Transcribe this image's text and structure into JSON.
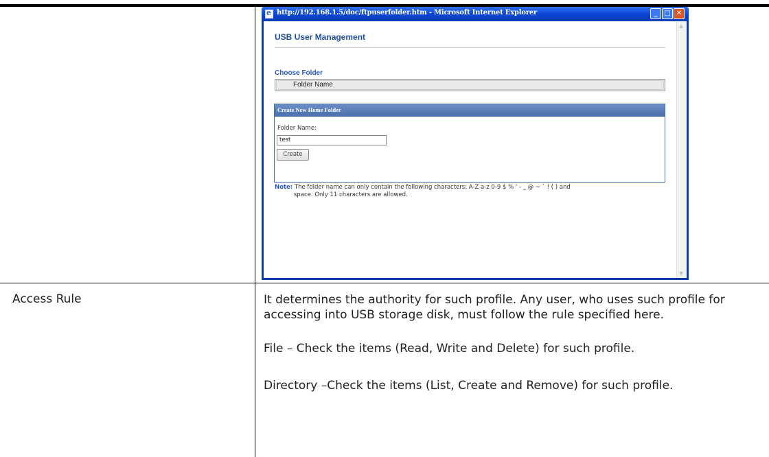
{
  "ie_window": {
    "title": "http://192.168.1.5/doc/ftpuserfolder.htm - Microsoft Internet Explorer",
    "controls": {
      "minimize": "_",
      "maximize": "□",
      "close": "✕"
    }
  },
  "dialog": {
    "title": "USB User Management",
    "choose_folder_label": "Choose Folder",
    "folder_name_header": "Folder Name",
    "create_panel": {
      "header": "Create New Home Folder",
      "folder_name_label": "Folder Name:",
      "folder_name_value": "test",
      "create_button": "Create"
    },
    "note_label": "Note:",
    "note_line1": "The folder name can only contain the following characters: A-Z a-z 0-9 $ % ' - _ @ ~ ` ! ( ) and",
    "note_line2": "space. Only 11 characters are allowed."
  },
  "table": {
    "row_label": "Access Rule",
    "para1": "It determines the authority for such profile. Any user, who uses such profile for accessing into USB storage disk, must follow the rule specified here.",
    "para2_term": "File",
    "para2_text": " – Check the items (Read, Write and Delete) for such profile.",
    "para3_term": "Directory",
    "para3_text": " –Check the items (List, Create and Remove) for such profile."
  }
}
